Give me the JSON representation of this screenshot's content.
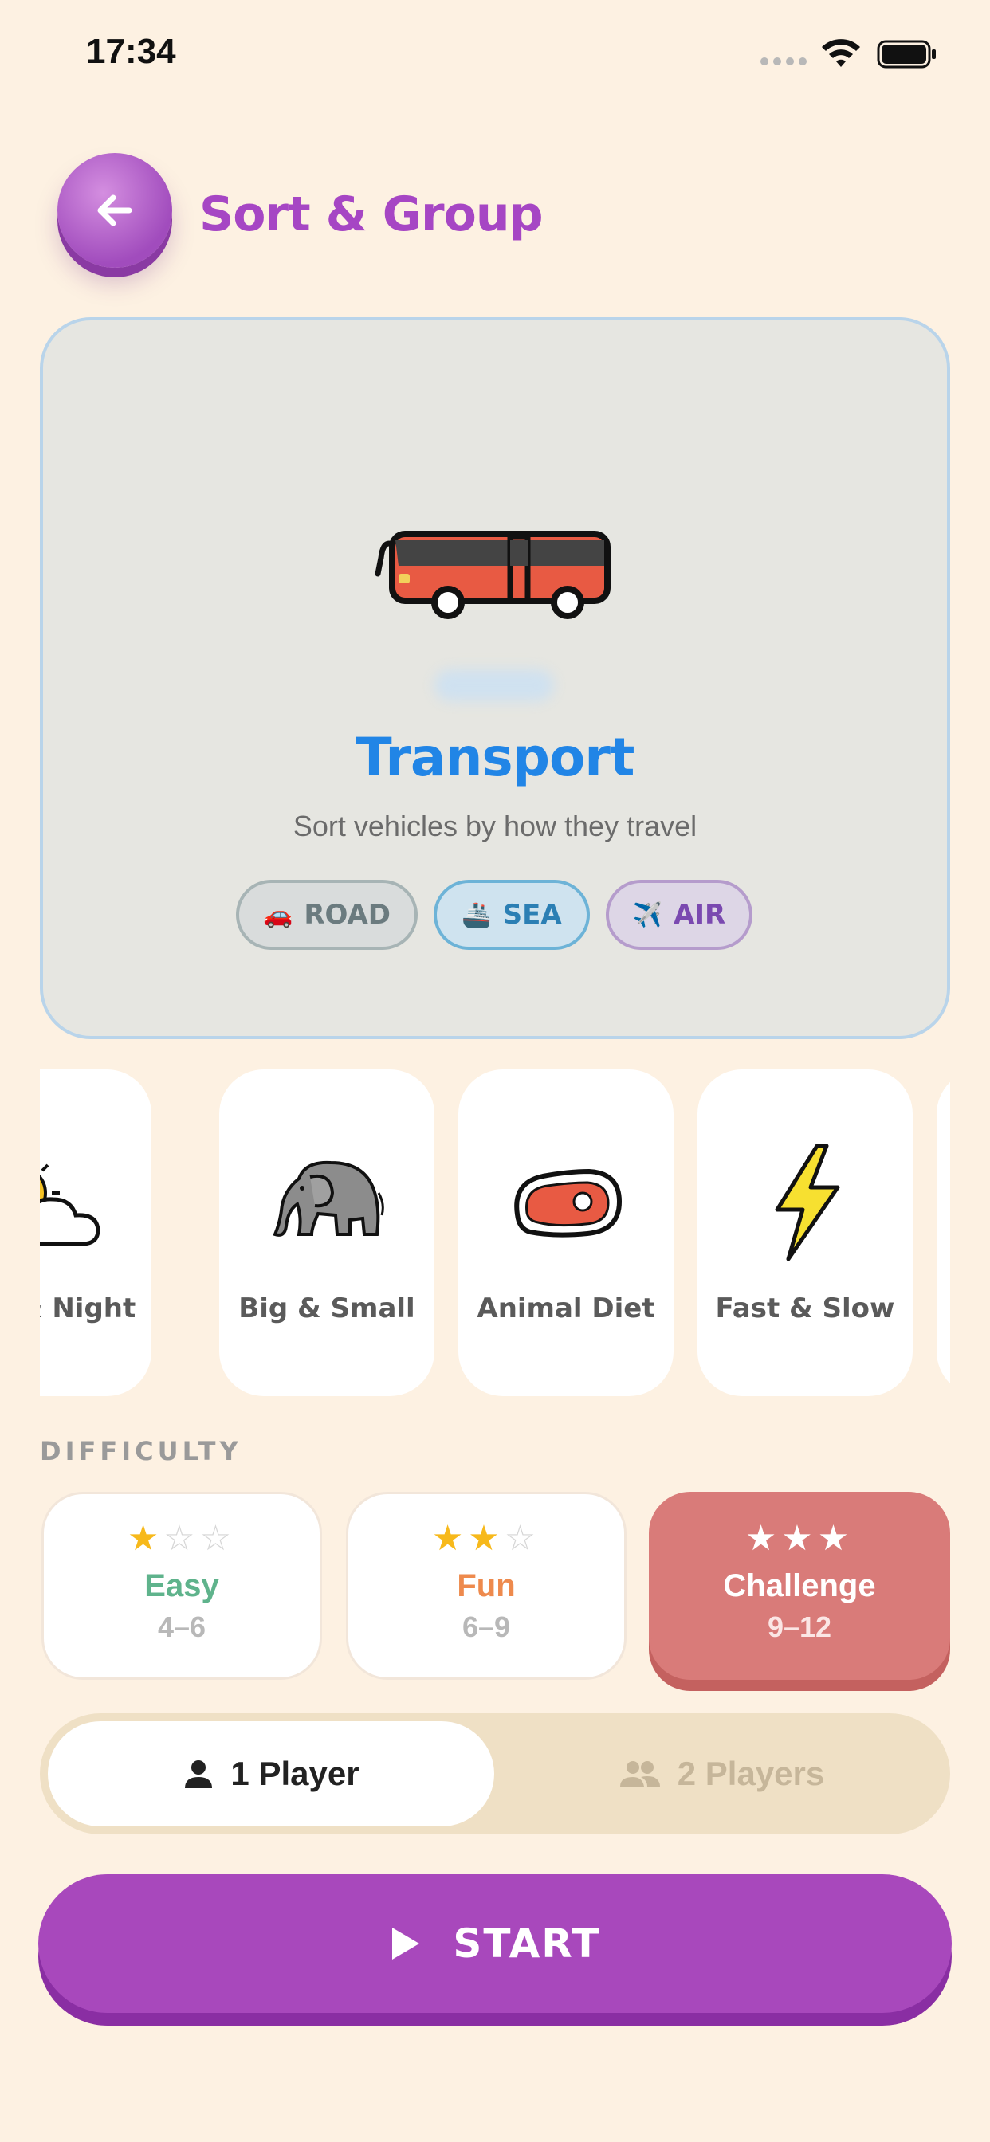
{
  "status": {
    "time": "17:34"
  },
  "header": {
    "title": "Sort & Group",
    "back_icon": "arrow-left-icon"
  },
  "hero": {
    "title": "Transport",
    "subtitle": "Sort vehicles by how they travel",
    "icon": "bus-icon",
    "chips": [
      {
        "label": "ROAD",
        "icon": "🚗"
      },
      {
        "label": "SEA",
        "icon": "🚢"
      },
      {
        "label": "AIR",
        "icon": "✈️"
      }
    ]
  },
  "categories": [
    {
      "label": "Day & Night",
      "icon": "sun-cloud-icon"
    },
    {
      "label": "Big & Small",
      "icon": "elephant-icon"
    },
    {
      "label": "Animal Diet",
      "icon": "meat-icon"
    },
    {
      "label": "Fast & Slow",
      "icon": "lightning-icon"
    }
  ],
  "difficulty": {
    "heading": "DIFFICULTY",
    "options": [
      {
        "name": "Easy",
        "range": "4–6",
        "stars": 1,
        "color": "#5fb38c"
      },
      {
        "name": "Fun",
        "range": "6–9",
        "stars": 2,
        "color": "#ee8a4d"
      },
      {
        "name": "Challenge",
        "range": "9–12",
        "stars": 3,
        "color": "#ffffff",
        "selected": true
      }
    ]
  },
  "players": {
    "one": "1 Player",
    "two": "2 Players",
    "selected": "one"
  },
  "start": {
    "label": "START"
  },
  "colors": {
    "background": "#fdf1e2",
    "accent": "#a848bc",
    "hero_title": "#2185e6",
    "challenge": "#d97b79"
  }
}
